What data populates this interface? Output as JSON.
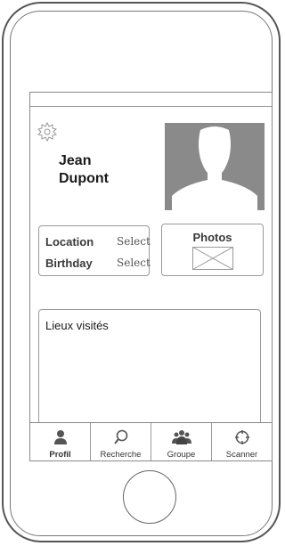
{
  "profile": {
    "first_name": "Jean",
    "last_name": "Dupont"
  },
  "info": {
    "location_label": "Location",
    "location_value": "Select",
    "birthday_label": "Birthday",
    "birthday_value": "Select"
  },
  "photos": {
    "title": "Photos"
  },
  "places": {
    "title": "Lieux visités"
  },
  "tabs": [
    {
      "label": "Profil",
      "icon": "person-icon",
      "active": true
    },
    {
      "label": "Recherche",
      "icon": "search-icon",
      "active": false
    },
    {
      "label": "Groupe",
      "icon": "group-icon",
      "active": false
    },
    {
      "label": "Scanner",
      "icon": "target-icon",
      "active": false
    }
  ],
  "colors": {
    "photo_placeholder": "#8a8a8a",
    "outline": "#999999"
  }
}
